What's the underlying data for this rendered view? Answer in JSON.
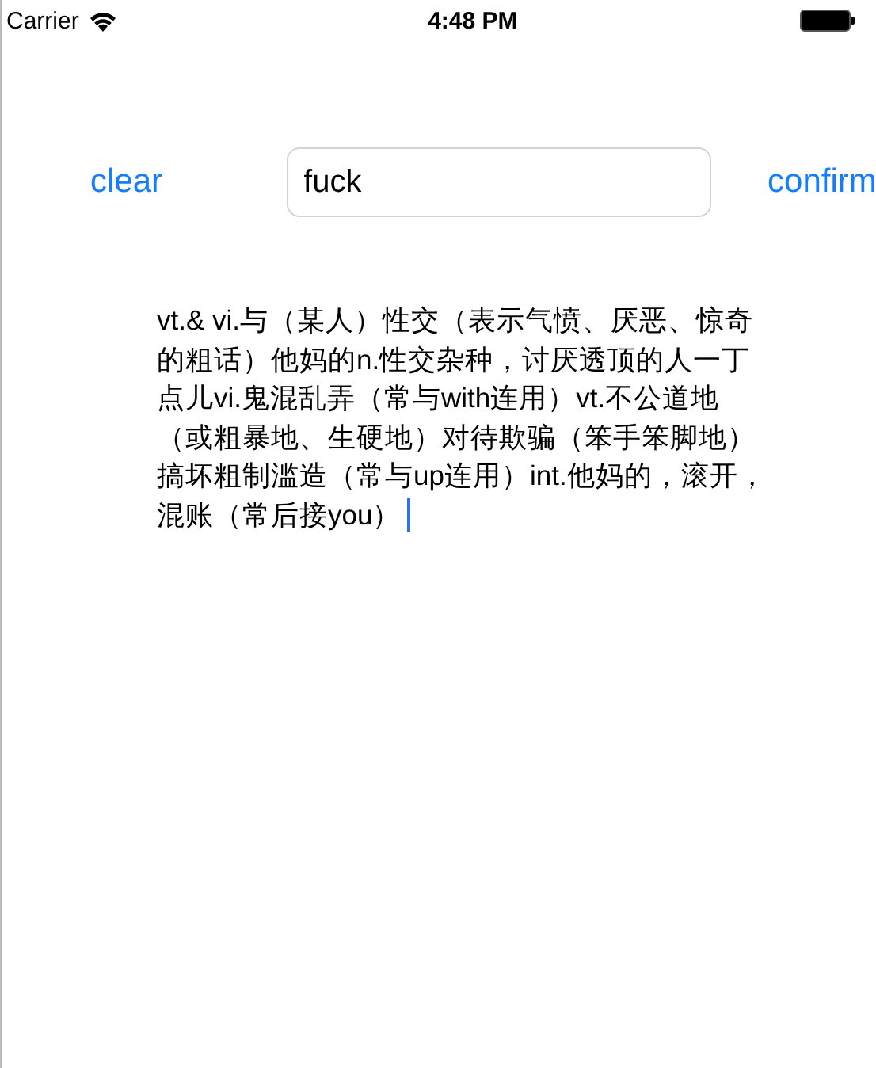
{
  "status_bar": {
    "carrier": "Carrier",
    "time": "4:48 PM"
  },
  "toolbar": {
    "clear_button": "clear",
    "search_field": {
      "value": "fuck"
    },
    "confirm_button": "confirm"
  },
  "definition": {
    "text": "vt.& vi.与（某人）性交（表示气愤、厌恶、惊奇的粗话）他妈的n.性交杂种，讨厌透顶的人一丁点儿vi.鬼混乱弄（常与with连用）vt.不公道地（或粗暴地、生硬地）对待欺骗（笨手笨脚地）搞坏粗制滥造（常与up连用）int.他妈的，滚开，混账（常后接you）",
    "focused": true
  }
}
